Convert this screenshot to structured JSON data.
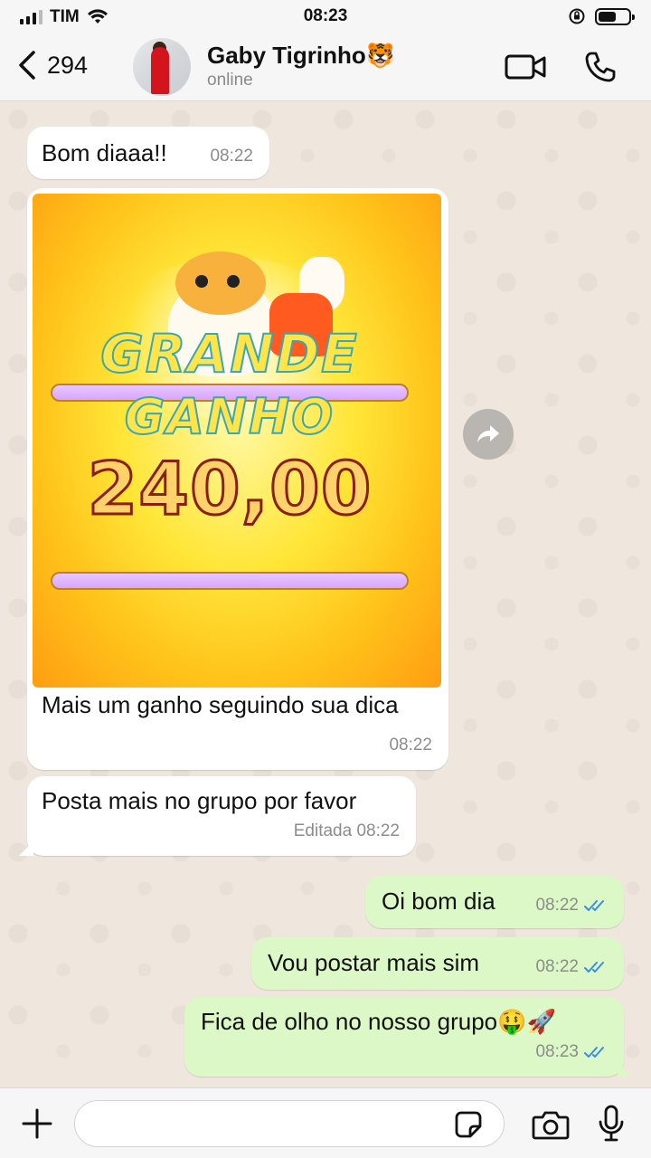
{
  "status_bar": {
    "carrier": "TIM",
    "time": "08:23"
  },
  "header": {
    "back_count": "294",
    "contact_name": "Gaby Tigrinho🐯",
    "contact_status": "online"
  },
  "messages": [
    {
      "direction": "in",
      "text": "Bom diaaa!!",
      "time": "08:22"
    },
    {
      "direction": "in",
      "type": "image",
      "image_text": {
        "line1": "GRANDE",
        "line2": "GANHO",
        "value": "240,00"
      },
      "text": "Mais um ganho seguindo sua dica",
      "time": "08:22"
    },
    {
      "direction": "in",
      "text": "Posta mais no grupo por favor",
      "time": "Editada 08:22"
    },
    {
      "direction": "out",
      "text": "Oi bom dia",
      "time": "08:22",
      "status": "read"
    },
    {
      "direction": "out",
      "text": "Vou postar mais sim",
      "time": "08:22",
      "status": "read"
    },
    {
      "direction": "out",
      "text": "Fica de olho no nosso grupo🤑🚀",
      "time": "08:23",
      "status": "read"
    }
  ],
  "input": {
    "placeholder": ""
  },
  "colors": {
    "incoming_bubble": "#ffffff",
    "outgoing_bubble": "#dcf8c6",
    "read_ticks": "#3a8ee6",
    "chat_background": "#efe7dd"
  },
  "icons": [
    "back-chevron-icon",
    "video-call-icon",
    "phone-icon",
    "forward-icon",
    "plus-icon",
    "sticker-icon",
    "camera-icon",
    "microphone-icon",
    "wifi-icon",
    "signal-icon",
    "battery-icon",
    "rotation-lock-icon"
  ]
}
